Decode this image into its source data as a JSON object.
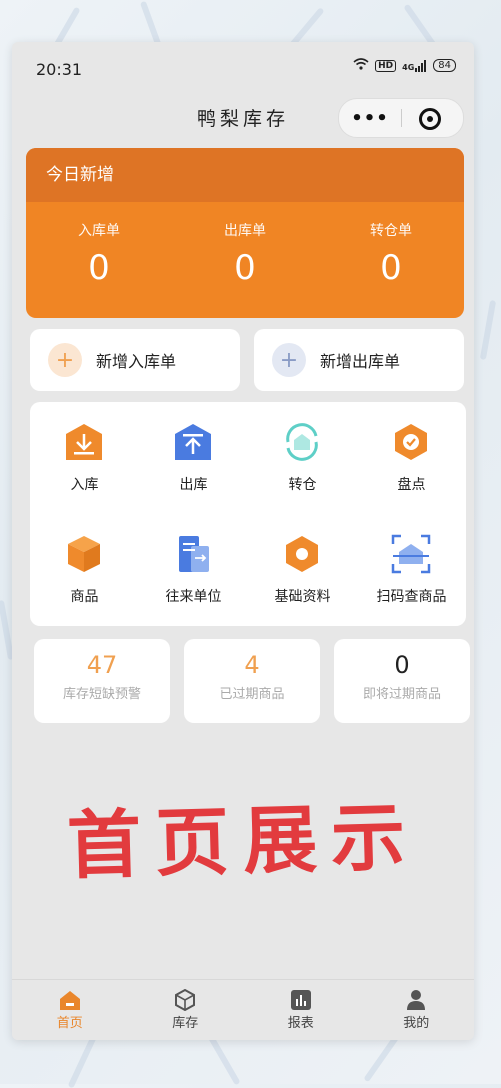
{
  "status": {
    "time": "20:31",
    "signal": "4G",
    "hd": "HD",
    "battery": "84"
  },
  "app": {
    "title": "鸭梨库存",
    "menu_glyph": "•••"
  },
  "today": {
    "title": "今日新增",
    "items": [
      {
        "label": "入库单",
        "value": "0"
      },
      {
        "label": "出库单",
        "value": "0"
      },
      {
        "label": "转仓单",
        "value": "0"
      }
    ]
  },
  "quick": [
    {
      "label": "新增入库单",
      "glyph": "+",
      "color": "#f0a050"
    },
    {
      "label": "新增出库单",
      "glyph": "+",
      "color": "#8a9bc5"
    }
  ],
  "grid": [
    {
      "label": "入库",
      "icon": "inbound-icon"
    },
    {
      "label": "出库",
      "icon": "outbound-icon"
    },
    {
      "label": "转仓",
      "icon": "transfer-icon"
    },
    {
      "label": "盘点",
      "icon": "stocktake-icon"
    },
    {
      "label": "商品",
      "icon": "product-icon"
    },
    {
      "label": "往来单位",
      "icon": "partner-icon"
    },
    {
      "label": "基础资料",
      "icon": "basic-data-icon"
    },
    {
      "label": "扫码查商品",
      "icon": "scan-icon"
    }
  ],
  "stats": [
    {
      "value": "47",
      "label": "库存短缺预警",
      "color": "#f0a050"
    },
    {
      "value": "4",
      "label": "已过期商品",
      "color": "#f0a050"
    },
    {
      "value": "0",
      "label": "即将过期商品",
      "color": "#222222"
    }
  ],
  "banner": "首页展示",
  "tabs": [
    {
      "label": "首页",
      "active": true
    },
    {
      "label": "库存"
    },
    {
      "label": "报表"
    },
    {
      "label": "我的"
    }
  ],
  "colors": {
    "accent": "#f08524",
    "accent_dark": "#de7425",
    "banner": "#e23b3e",
    "blue": "#4a7be0",
    "teal": "#5ecfc7"
  }
}
